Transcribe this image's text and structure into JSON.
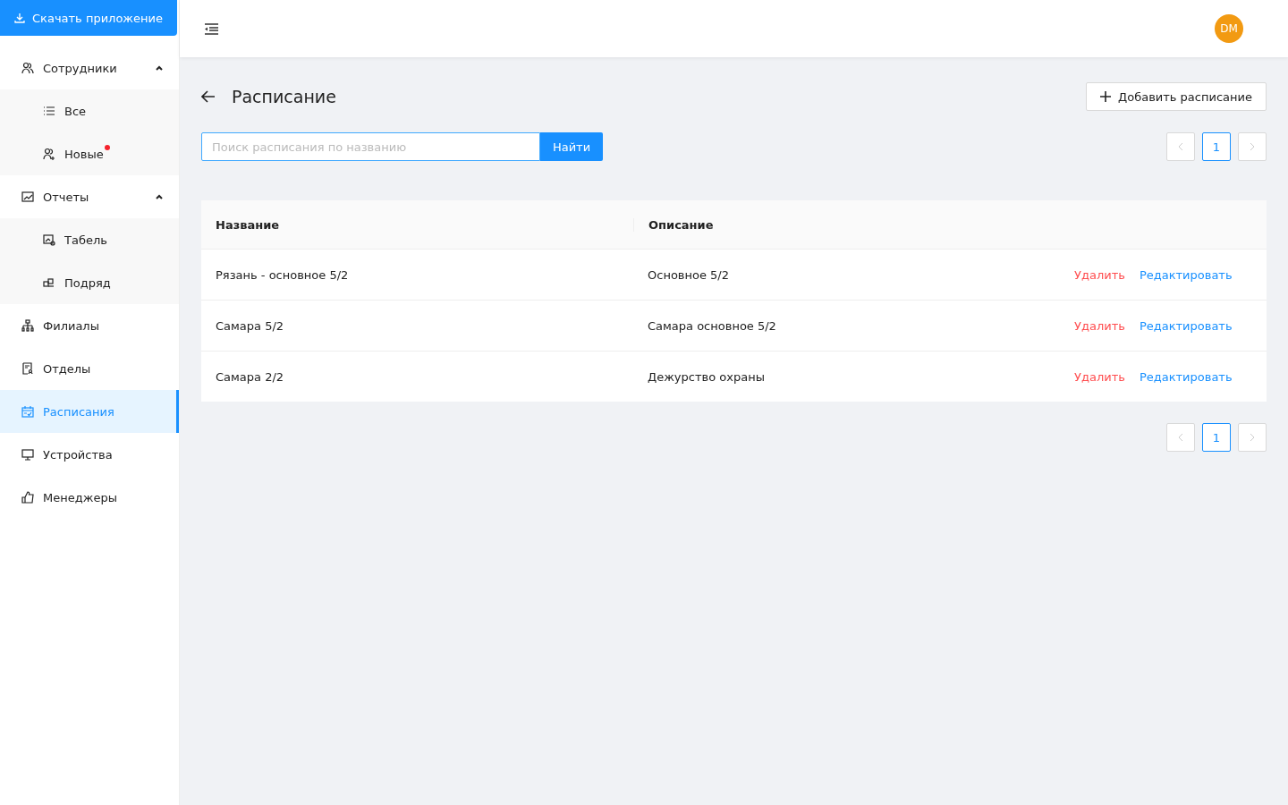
{
  "download_button": "Скачать приложение",
  "sidebar": {
    "items": [
      {
        "label": "Сотрудники",
        "selected": false,
        "expanded": true,
        "children": [
          {
            "label": "Все",
            "selected": false,
            "notification": false
          },
          {
            "label": "Новые",
            "selected": false,
            "notification": true
          }
        ]
      },
      {
        "label": "Отчеты",
        "selected": false,
        "expanded": true,
        "children": [
          {
            "label": "Табель",
            "selected": false,
            "notification": false
          },
          {
            "label": "Подряд",
            "selected": false,
            "notification": false
          }
        ]
      },
      {
        "label": "Филиалы",
        "selected": false
      },
      {
        "label": "Отделы",
        "selected": false
      },
      {
        "label": "Расписания",
        "selected": true
      },
      {
        "label": "Устройства",
        "selected": false
      },
      {
        "label": "Менеджеры",
        "selected": false
      }
    ]
  },
  "header": {
    "avatar": "DM"
  },
  "page": {
    "title": "Расписание",
    "add_button": "Добавить расписание",
    "search": {
      "placeholder": "Поиск расписания по названию",
      "button": "Найти"
    }
  },
  "pagination_top": {
    "prev_disabled": true,
    "next_disabled": true,
    "pages": [
      {
        "label": "1",
        "selected": true
      }
    ]
  },
  "table": {
    "columns": [
      "Название",
      "Описание"
    ],
    "rows": [
      {
        "name": "Рязань - основное 5/2",
        "description": "Основное 5/2",
        "actions": [
          "Удалить",
          "Редактировать"
        ]
      },
      {
        "name": "Самара 5/2",
        "description": "Самара основное 5/2",
        "actions": [
          "Удалить",
          "Редактировать"
        ]
      },
      {
        "name": "Самара 2/2",
        "description": "Дежурство охраны",
        "actions": [
          "Удалить",
          "Редактировать"
        ]
      }
    ]
  },
  "pagination_bottom": {
    "prev_disabled": true,
    "next_disabled": true,
    "pages": [
      {
        "label": "1",
        "selected": true
      }
    ]
  }
}
